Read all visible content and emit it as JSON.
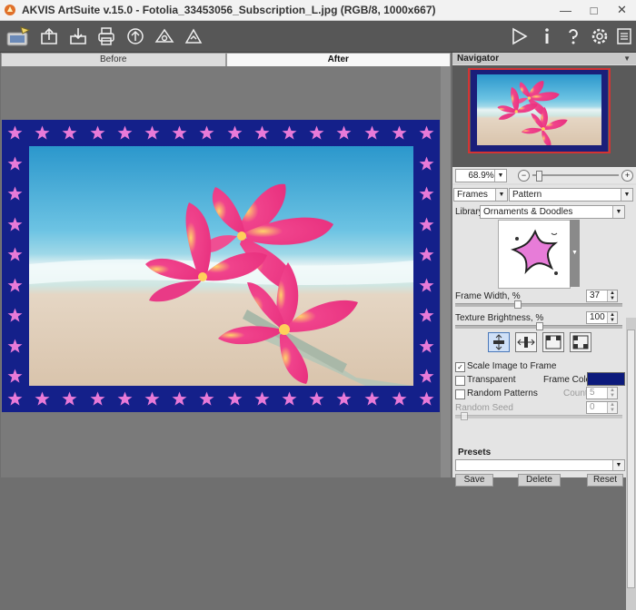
{
  "window": {
    "title": "AKVIS ArtSuite v.15.0 - Fotolia_33453056_Subscription_L.jpg (RGB/8, 1000x667)",
    "controls": [
      "minimize",
      "maximize",
      "close"
    ]
  },
  "toolbar": {
    "left_icons": [
      "app-logo-icon",
      "open-image-icon",
      "save-image-icon",
      "print-icon",
      "share-icon",
      "batch-icon",
      "plugin-icon"
    ],
    "right_icons": [
      "run-icon",
      "info-icon",
      "help-icon",
      "settings-icon",
      "menu-icon"
    ]
  },
  "tabs": [
    {
      "label": "Before",
      "active": false
    },
    {
      "label": "After",
      "active": true
    }
  ],
  "navigator": {
    "title": "Navigator",
    "zoom": "68.9%"
  },
  "settings": {
    "effect": "Frames",
    "frame_type": "Pattern",
    "library_label": "Library",
    "library_value": "Ornaments & Doodles",
    "frame_width_label": "Frame Width, %",
    "frame_width_value": "37",
    "frame_width_level": 0.37,
    "texture_brightness_label": "Texture Brightness, %",
    "texture_brightness_value": "100",
    "texture_brightness_level": 0.5,
    "scale_image_label": "Scale Image to Frame",
    "scale_image_checked": true,
    "transparent_label": "Transparent",
    "transparent_checked": false,
    "frame_color_label": "Frame Color",
    "frame_color": "#0c1a7c",
    "random_patterns_label": "Random Patterns",
    "random_patterns_checked": false,
    "count_label": "Count",
    "count_value": "5",
    "random_seed_label": "Random Seed",
    "random_seed_value": "0"
  },
  "presets": {
    "title": "Presets",
    "save_label": "Save",
    "delete_label": "Delete",
    "reset_label": "Reset"
  },
  "colors": {
    "frame_blue": "#14208a",
    "star_pink": "#e87ad8"
  }
}
